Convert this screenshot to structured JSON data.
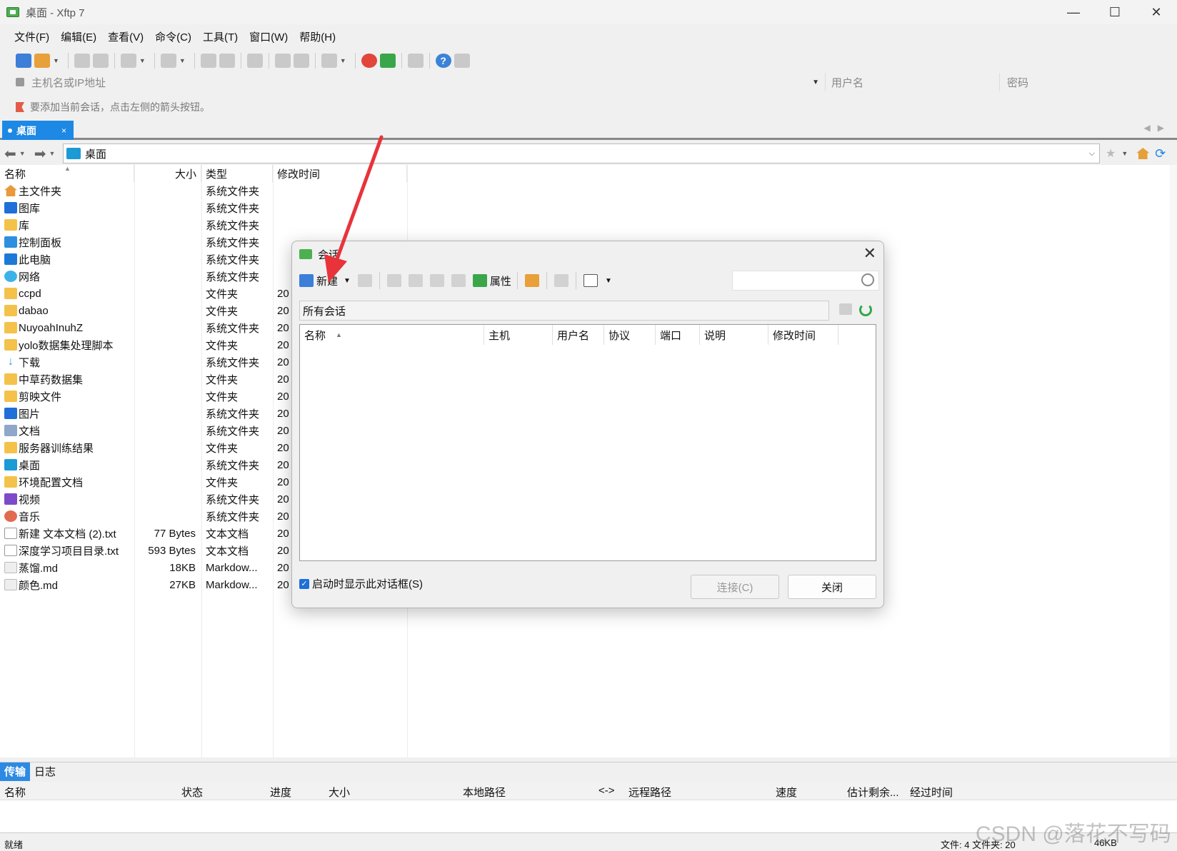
{
  "window": {
    "title": "桌面 - Xftp 7",
    "minimize": "—",
    "maximize": "☐",
    "close": "✕"
  },
  "menu": [
    "文件(F)",
    "编辑(E)",
    "查看(V)",
    "命令(C)",
    "工具(T)",
    "窗口(W)",
    "帮助(H)"
  ],
  "address": {
    "host_placeholder": "主机名或IP地址",
    "user_placeholder": "用户名",
    "password_placeholder": "密码"
  },
  "hint": "要添加当前会话，点击左侧的箭头按钮。",
  "tab": {
    "label": "桌面",
    "close": "×"
  },
  "nav": {
    "path": "桌面"
  },
  "file_columns": {
    "name": "名称",
    "size": "大小",
    "type": "类型",
    "modified": "修改时间"
  },
  "files": [
    {
      "name": "主文件夹",
      "size": "",
      "type": "系统文件夹",
      "date": "",
      "icon": "home-icon"
    },
    {
      "name": "图库",
      "size": "",
      "type": "系统文件夹",
      "date": "",
      "icon": "gallery-icon"
    },
    {
      "name": "库",
      "size": "",
      "type": "系统文件夹",
      "date": "",
      "icon": "folder-icon"
    },
    {
      "name": "控制面板",
      "size": "",
      "type": "系统文件夹",
      "date": "",
      "icon": "control-panel-icon"
    },
    {
      "name": "此电脑",
      "size": "",
      "type": "系统文件夹",
      "date": "",
      "icon": "computer-icon"
    },
    {
      "name": "网络",
      "size": "",
      "type": "系统文件夹",
      "date": "",
      "icon": "network-icon"
    },
    {
      "name": "ccpd",
      "size": "",
      "type": "文件夹",
      "date": "20",
      "icon": "folder-icon"
    },
    {
      "name": "dabao",
      "size": "",
      "type": "文件夹",
      "date": "20",
      "icon": "folder-icon"
    },
    {
      "name": "NuyoahInuhZ",
      "size": "",
      "type": "系统文件夹",
      "date": "20",
      "icon": "folder-icon"
    },
    {
      "name": "yolo数据集处理脚本",
      "size": "",
      "type": "文件夹",
      "date": "20",
      "icon": "folder-icon"
    },
    {
      "name": "下载",
      "size": "",
      "type": "系统文件夹",
      "date": "20",
      "icon": "download-icon"
    },
    {
      "name": "中草药数据集",
      "size": "",
      "type": "文件夹",
      "date": "20",
      "icon": "folder-icon"
    },
    {
      "name": "剪映文件",
      "size": "",
      "type": "文件夹",
      "date": "20",
      "icon": "folder-icon"
    },
    {
      "name": "图片",
      "size": "",
      "type": "系统文件夹",
      "date": "20",
      "icon": "pictures-icon"
    },
    {
      "name": "文档",
      "size": "",
      "type": "系统文件夹",
      "date": "20",
      "icon": "documents-icon"
    },
    {
      "name": "服务器训练结果",
      "size": "",
      "type": "文件夹",
      "date": "20",
      "icon": "folder-icon"
    },
    {
      "name": "桌面",
      "size": "",
      "type": "系统文件夹",
      "date": "20",
      "icon": "desktop-icon"
    },
    {
      "name": "环境配置文档",
      "size": "",
      "type": "文件夹",
      "date": "20",
      "icon": "folder-icon"
    },
    {
      "name": "视频",
      "size": "",
      "type": "系统文件夹",
      "date": "20",
      "icon": "video-icon"
    },
    {
      "name": "音乐",
      "size": "",
      "type": "系统文件夹",
      "date": "20",
      "icon": "music-icon"
    },
    {
      "name": "新建 文本文档 (2).txt",
      "size": "77 Bytes",
      "type": "文本文档",
      "date": "20",
      "icon": "text-file-icon"
    },
    {
      "name": "深度学习项目目录.txt",
      "size": "593 Bytes",
      "type": "文本文档",
      "date": "20",
      "icon": "text-file-icon"
    },
    {
      "name": "蒸馏.md",
      "size": "18KB",
      "type": "Markdow...",
      "date": "20",
      "icon": "markdown-file-icon"
    },
    {
      "name": "颜色.md",
      "size": "27KB",
      "type": "Markdow...",
      "date": "20",
      "icon": "markdown-file-icon"
    }
  ],
  "dialog": {
    "title": "会话",
    "new_label": "新建",
    "properties_label": "属性",
    "crumb": "所有会话",
    "columns": [
      "名称",
      "主机",
      "用户名",
      "协议",
      "端口",
      "说明",
      "修改时间"
    ],
    "show_on_start": "启动时显示此对话框(S)",
    "connect": "连接(C)",
    "close": "关闭"
  },
  "bottom_tabs": [
    "传输",
    "日志"
  ],
  "transfer_columns": [
    "名称",
    "状态",
    "进度",
    "大小",
    "本地路径",
    "<->",
    "远程路径",
    "速度",
    "估计剩余...",
    "经过时间"
  ],
  "status": {
    "left": "就绪",
    "right": "文件: 4  文件夹: 20",
    "size": "46KB"
  },
  "watermark": "CSDN @落花不写码",
  "colors": {
    "accent": "#1e88e5",
    "annotation_arrow": "#e8333a"
  }
}
